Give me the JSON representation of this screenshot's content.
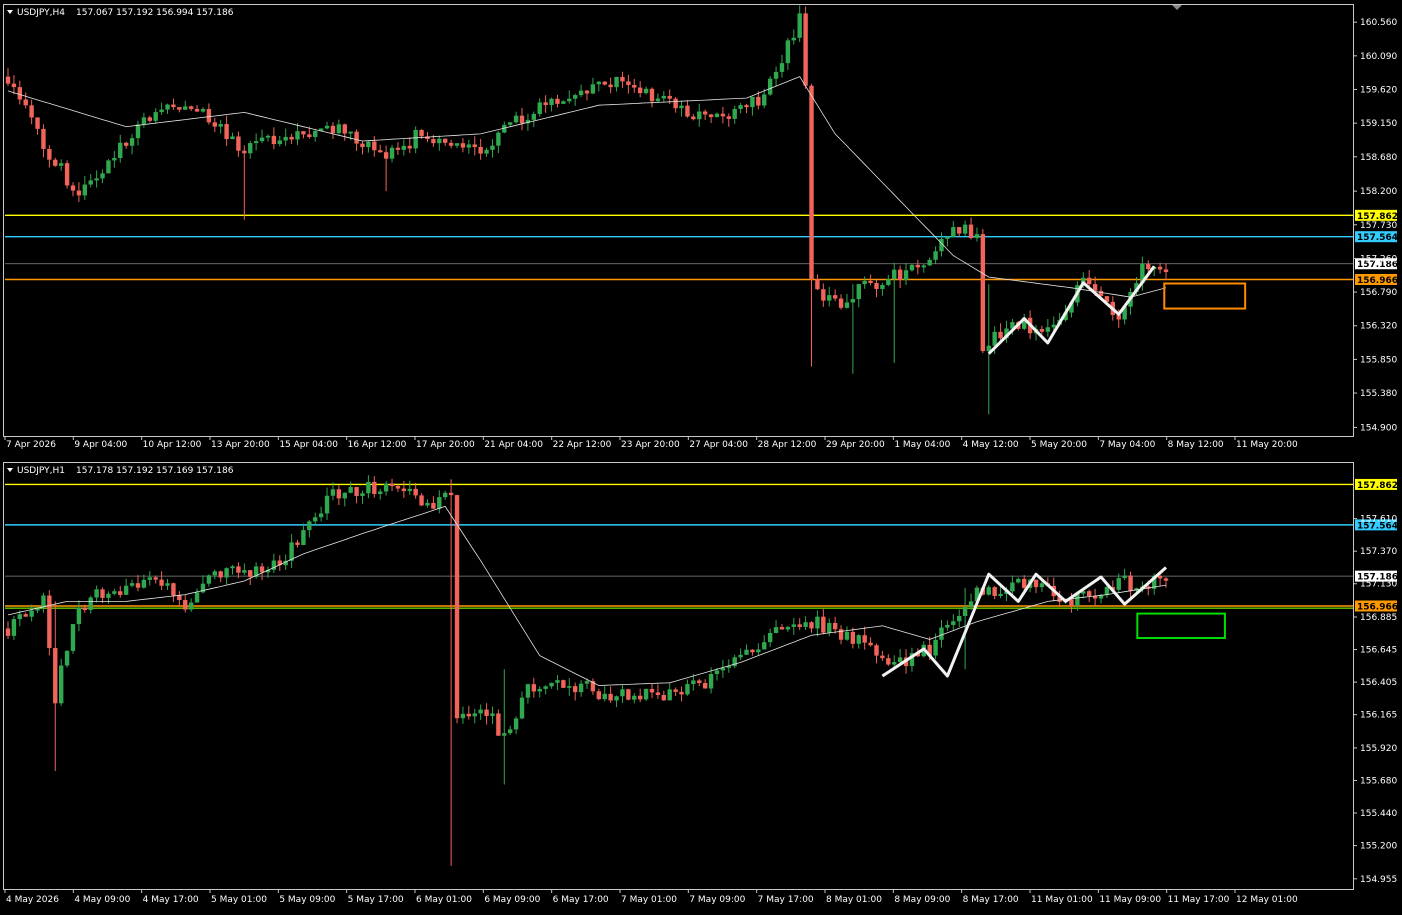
{
  "window": {
    "scroll_marker_icon": "triangle-down-icon",
    "accent_colors": {
      "bull": "#2fa84f",
      "bear": "#f0645a",
      "ma": "#e6e6e6",
      "resistance": "#ffff00",
      "cyan_level": "#33ccff",
      "orange_level": "#ff9900",
      "green_level": "#66cc00",
      "orange_box": "#ff8c00",
      "green_box": "#00dd00"
    }
  },
  "chart_data": [
    {
      "type": "candlestick",
      "symbol_header": "USDJPY,H4",
      "ohlc_header": "157.067 157.192 156.994 157.186",
      "ylim": [
        154.78,
        160.8
      ],
      "y_ticks": [
        "160.560",
        "160.090",
        "159.620",
        "159.150",
        "158.680",
        "158.200",
        "157.730",
        "157.260",
        "156.790",
        "156.320",
        "155.850",
        "155.380",
        "154.900"
      ],
      "x_ticks": [
        "7 Apr 2026",
        "9 Apr 04:00",
        "10 Apr 12:00",
        "13 Apr 20:00",
        "15 Apr 04:00",
        "16 Apr 12:00",
        "17 Apr 20:00",
        "21 Apr 04:00",
        "22 Apr 12:00",
        "23 Apr 20:00",
        "27 Apr 04:00",
        "28 Apr 12:00",
        "29 Apr 20:00",
        "1 May 04:00",
        "4 May 12:00",
        "5 May 20:00",
        "7 May 04:00",
        "8 May 12:00",
        "11 May 20:00"
      ],
      "levels": [
        {
          "label": "157.862",
          "value": 157.862,
          "color": "#ffff00"
        },
        {
          "label": "157.564",
          "value": 157.564,
          "color": "#33ccff"
        },
        {
          "label": "157.186",
          "value": 157.186,
          "color": "#888888"
        },
        {
          "label": "156.966",
          "value": 156.966,
          "color": "#ff9900"
        }
      ],
      "anchors": [
        [
          0,
          159.8
        ],
        [
          6,
          158.8
        ],
        [
          12,
          158.1
        ],
        [
          20,
          158.9
        ],
        [
          28,
          159.5
        ],
        [
          40,
          158.8
        ],
        [
          48,
          159.0
        ],
        [
          56,
          159.1
        ],
        [
          64,
          158.7
        ],
        [
          70,
          159.0
        ],
        [
          80,
          158.8
        ],
        [
          88,
          159.3
        ],
        [
          96,
          159.5
        ],
        [
          104,
          159.8
        ],
        [
          112,
          159.4
        ],
        [
          120,
          159.2
        ],
        [
          128,
          159.5
        ],
        [
          134,
          160.6
        ],
        [
          135,
          159.6
        ],
        [
          136,
          156.9
        ],
        [
          140,
          156.6
        ],
        [
          146,
          156.9
        ],
        [
          154,
          157.1
        ],
        [
          160,
          157.7
        ],
        [
          164,
          157.6
        ],
        [
          165,
          156.0
        ],
        [
          170,
          156.4
        ],
        [
          176,
          156.2
        ],
        [
          182,
          156.9
        ],
        [
          188,
          156.5
        ],
        [
          192,
          157.1
        ],
        [
          196,
          157.186
        ]
      ],
      "wicks": {
        "136": [
          159.7,
          155.75
        ],
        "143": [
          156.9,
          155.65
        ],
        "150": [
          157.2,
          155.8
        ],
        "166": [
          156.9,
          155.08
        ],
        "40": [
          158.6,
          157.8
        ],
        "64": [
          158.7,
          158.2
        ]
      },
      "ma_anchors": [
        [
          0,
          159.6
        ],
        [
          20,
          159.1
        ],
        [
          40,
          159.3
        ],
        [
          60,
          158.9
        ],
        [
          80,
          159.0
        ],
        [
          100,
          159.4
        ],
        [
          125,
          159.5
        ],
        [
          134,
          159.8
        ],
        [
          140,
          159.0
        ],
        [
          160,
          157.3
        ],
        [
          166,
          157.0
        ],
        [
          180,
          156.85
        ],
        [
          190,
          156.72
        ],
        [
          196,
          156.85
        ]
      ],
      "zigzag": [
        [
          166,
          155.93
        ],
        [
          172,
          156.42
        ],
        [
          176,
          156.08
        ],
        [
          182,
          156.92
        ],
        [
          188,
          156.48
        ],
        [
          194,
          157.15
        ]
      ],
      "box": {
        "x0": 0.86,
        "x1": 0.92,
        "y_top": 156.91,
        "y_bot": 156.56,
        "color": "#ff8c00"
      }
    },
    {
      "type": "candlestick",
      "symbol_header": "USDJPY,H1",
      "ohlc_header": "157.178 157.192 157.169 157.186",
      "ylim": [
        154.88,
        158.02
      ],
      "y_ticks": [
        "157.610",
        "157.370",
        "157.130",
        "156.885",
        "156.645",
        "156.405",
        "156.165",
        "155.920",
        "155.680",
        "155.440",
        "155.200",
        "154.955"
      ],
      "x_ticks": [
        "4 May 2026",
        "4 May 09:00",
        "4 May 17:00",
        "5 May 01:00",
        "5 May 09:00",
        "5 May 17:00",
        "6 May 01:00",
        "6 May 09:00",
        "6 May 17:00",
        "7 May 01:00",
        "7 May 09:00",
        "7 May 17:00",
        "8 May 01:00",
        "8 May 09:00",
        "8 May 17:00",
        "11 May 01:00",
        "11 May 09:00",
        "11 May 17:00",
        "12 May 01:00"
      ],
      "levels": [
        {
          "label": "157.862",
          "value": 157.862,
          "color": "#ffff00"
        },
        {
          "label": "157.564",
          "value": 157.564,
          "color": "#33ccff"
        },
        {
          "label": "157.186",
          "value": 157.186,
          "color": "#888888"
        },
        {
          "label": "156.966",
          "value": 156.966,
          "color": "#ff9900"
        },
        {
          "label": "",
          "value": 156.95,
          "color": "#66cc00"
        }
      ],
      "anchors": [
        [
          0,
          156.8
        ],
        [
          6,
          157.0
        ],
        [
          8,
          156.3
        ],
        [
          12,
          157.0
        ],
        [
          20,
          157.1
        ],
        [
          25,
          157.2
        ],
        [
          30,
          156.95
        ],
        [
          35,
          157.2
        ],
        [
          45,
          157.25
        ],
        [
          48,
          157.4
        ],
        [
          55,
          157.8
        ],
        [
          65,
          157.85
        ],
        [
          72,
          157.7
        ],
        [
          75,
          157.8
        ],
        [
          76,
          156.1
        ],
        [
          80,
          156.2
        ],
        [
          84,
          156.0
        ],
        [
          88,
          156.35
        ],
        [
          95,
          156.4
        ],
        [
          100,
          156.3
        ],
        [
          110,
          156.3
        ],
        [
          118,
          156.4
        ],
        [
          125,
          156.6
        ],
        [
          130,
          156.8
        ],
        [
          136,
          156.85
        ],
        [
          142,
          156.75
        ],
        [
          148,
          156.6
        ],
        [
          152,
          156.55
        ],
        [
          156,
          156.65
        ],
        [
          160,
          156.9
        ],
        [
          164,
          157.05
        ],
        [
          172,
          157.15
        ],
        [
          180,
          157.0
        ],
        [
          188,
          157.15
        ],
        [
          192,
          157.1
        ],
        [
          196,
          157.186
        ]
      ],
      "wicks": {
        "8": [
          157.0,
          155.75
        ],
        "75": [
          157.9,
          155.05
        ],
        "84": [
          156.5,
          155.65
        ],
        "162": [
          157.1,
          156.5
        ]
      },
      "ma_anchors": [
        [
          0,
          156.9
        ],
        [
          10,
          157.0
        ],
        [
          20,
          157.0
        ],
        [
          30,
          157.05
        ],
        [
          40,
          157.15
        ],
        [
          50,
          157.35
        ],
        [
          60,
          157.5
        ],
        [
          74,
          157.7
        ],
        [
          80,
          157.3
        ],
        [
          90,
          156.6
        ],
        [
          100,
          156.38
        ],
        [
          112,
          156.4
        ],
        [
          124,
          156.55
        ],
        [
          136,
          156.75
        ],
        [
          148,
          156.82
        ],
        [
          156,
          156.72
        ],
        [
          164,
          156.85
        ],
        [
          176,
          157.0
        ],
        [
          186,
          157.05
        ],
        [
          196,
          157.12
        ]
      ],
      "zigzag": [
        [
          148,
          156.45
        ],
        [
          155,
          156.65
        ],
        [
          159,
          156.45
        ],
        [
          166,
          157.2
        ],
        [
          171,
          157.0
        ],
        [
          174,
          157.2
        ],
        [
          179,
          157.0
        ],
        [
          185,
          157.18
        ],
        [
          189,
          156.98
        ],
        [
          196,
          157.25
        ]
      ],
      "box": {
        "x0": 0.84,
        "x1": 0.905,
        "y_top": 156.91,
        "y_bot": 156.73,
        "color": "#00dd00"
      }
    }
  ]
}
